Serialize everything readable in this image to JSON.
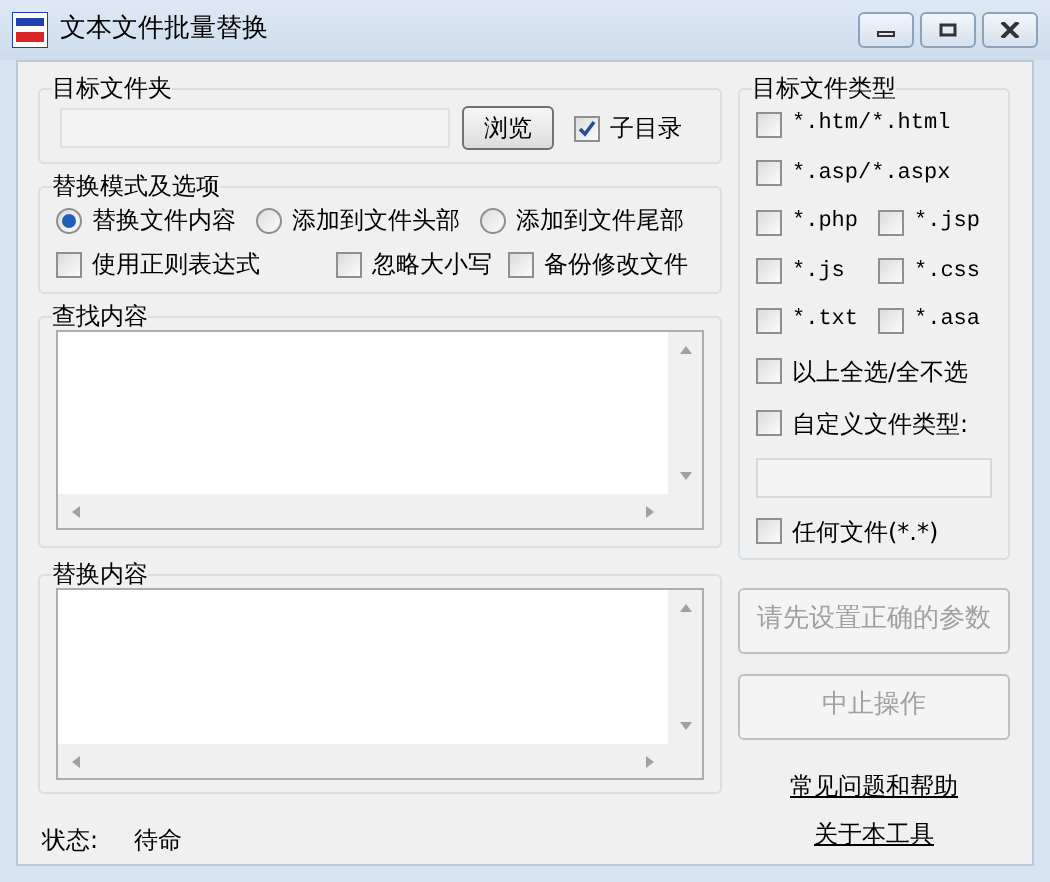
{
  "window": {
    "title": "文本文件批量替换"
  },
  "folder": {
    "label": "目标文件夹",
    "browse": "浏览",
    "subdirs": {
      "label": "子目录",
      "checked": true
    }
  },
  "mode": {
    "label": "替换模式及选项",
    "modes": [
      {
        "label": "替换文件内容",
        "selected": true
      },
      {
        "label": "添加到文件头部",
        "selected": false
      },
      {
        "label": "添加到文件尾部",
        "selected": false
      }
    ],
    "options": [
      {
        "label": "使用正则表达式",
        "checked": false
      },
      {
        "label": "忽略大小写",
        "checked": false
      },
      {
        "label": "备份修改文件",
        "checked": false
      }
    ]
  },
  "find": {
    "label": "查找内容"
  },
  "replace": {
    "label": "替换内容"
  },
  "file_types": {
    "label": "目标文件类型",
    "rows": [
      [
        {
          "label": "*.htm/*.html",
          "checked": false
        }
      ],
      [
        {
          "label": "*.asp/*.aspx",
          "checked": false
        }
      ],
      [
        {
          "label": "*.php",
          "checked": false
        },
        {
          "label": "*.jsp",
          "checked": false
        }
      ],
      [
        {
          "label": "*.js",
          "checked": false
        },
        {
          "label": "*.css",
          "checked": false
        }
      ],
      [
        {
          "label": "*.txt",
          "checked": false
        },
        {
          "label": "*.asa",
          "checked": false
        }
      ]
    ],
    "select_all": {
      "label": "以上全选/全不选",
      "checked": false
    },
    "custom": {
      "label": "自定义文件类型:",
      "checked": false
    },
    "any": {
      "label": "任何文件(*.*)",
      "checked": false
    }
  },
  "buttons": [
    {
      "label": "请先设置正确的参数",
      "disabled": true
    },
    {
      "label": "中止操作",
      "disabled": true
    }
  ],
  "links": [
    "常见问题和帮助",
    "关于本工具"
  ],
  "status": {
    "label": "状态:",
    "value": "待命"
  }
}
